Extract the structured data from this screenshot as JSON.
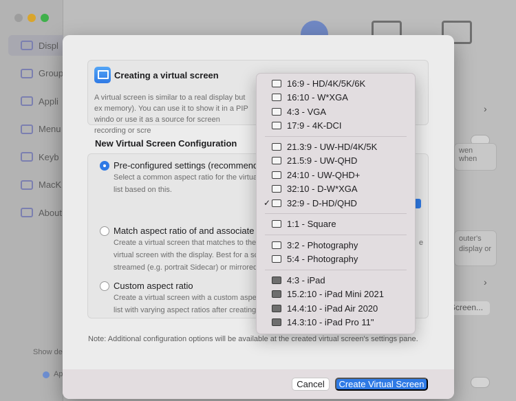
{
  "background": {
    "sidebar_items": [
      {
        "label": "Displ",
        "icon": "display-icon",
        "active": true
      },
      {
        "label": "Group",
        "icon": "group-icon"
      },
      {
        "label": "Appli",
        "icon": "app-icon"
      },
      {
        "label": "Menu",
        "icon": "menu-icon"
      },
      {
        "label": "Keyb",
        "icon": "keyboard-icon"
      },
      {
        "label": "MacK",
        "icon": "gear-icon"
      },
      {
        "label": "About",
        "icon": "tag-icon"
      }
    ],
    "bottom_left": "Show de",
    "bottom_row_label": "Ap",
    "right_fragments": [
      "wen when",
      "outer's",
      "display or"
    ],
    "screen_button": "Screen..."
  },
  "dialog": {
    "info_title": "Creating a virtual screen",
    "info_body": "A virtual screen is similar to a real display but ex memory). You can use it to show it in a PIP windo or use it as a source for screen recording or scre",
    "section_title": "New Virtual Screen Configuration",
    "options": [
      {
        "label": "Pre-configured settings (recommend",
        "selected": true,
        "desc": [
          "Select a common aspect ratio for the virtua",
          "list based on this."
        ]
      },
      {
        "label": "Match aspect ratio of and associate t",
        "selected": false,
        "desc": [
          "Create a virtual screen that matches to the",
          "virtual screen with the display. Best for a sc",
          "streamed (e.g. portrait Sidecar) or mirrored"
        ]
      },
      {
        "label": "Custom aspect ratio",
        "selected": false,
        "desc": [
          "Create a virtual screen with a custom aspect",
          "list with varying aspect ratios after creating"
        ]
      }
    ],
    "edge_fragment": "e",
    "note": "Note: Additional configuration options will be available at the created virtual screen's settings pane.",
    "cancel_label": "Cancel",
    "create_label": "Create Virtual Screen"
  },
  "menu": {
    "groups": [
      [
        {
          "label": "16:9 - HD/4K/5K/6K",
          "checked": false,
          "icon": "display-outline-icon"
        },
        {
          "label": "16:10 - W*XGA",
          "checked": false,
          "icon": "display-outline-icon"
        },
        {
          "label": "4:3 - VGA",
          "checked": false,
          "icon": "display-outline-icon"
        },
        {
          "label": "17:9 - 4K-DCI",
          "checked": false,
          "icon": "display-outline-icon"
        }
      ],
      [
        {
          "label": "21.3:9 - UW-HD/4K/5K",
          "checked": false,
          "icon": "display-outline-icon"
        },
        {
          "label": "21.5:9 - UW-QHD",
          "checked": false,
          "icon": "display-outline-icon"
        },
        {
          "label": "24:10 - UW-QHD+",
          "checked": false,
          "icon": "display-outline-icon"
        },
        {
          "label": "32:10 - D-W*XGA",
          "checked": false,
          "icon": "display-outline-icon"
        },
        {
          "label": "32:9 - D-HD/QHD",
          "checked": true,
          "icon": "display-outline-icon"
        }
      ],
      [
        {
          "label": "1:1 - Square",
          "checked": false,
          "icon": "display-outline-icon"
        }
      ],
      [
        {
          "label": "3:2 - Photography",
          "checked": false,
          "icon": "display-outline-icon"
        },
        {
          "label": "5:4 - Photography",
          "checked": false,
          "icon": "display-outline-icon"
        }
      ],
      [
        {
          "label": "4:3 - iPad",
          "checked": false,
          "icon": "ipad-icon"
        },
        {
          "label": "15.2:10 - iPad Mini 2021",
          "checked": false,
          "icon": "ipad-icon"
        },
        {
          "label": "14.4:10 - iPad Air 2020",
          "checked": false,
          "icon": "ipad-icon"
        },
        {
          "label": "14.3:10 - iPad Pro 11\"",
          "checked": false,
          "icon": "ipad-icon"
        }
      ]
    ],
    "check_glyph": "✓"
  },
  "colors": {
    "accent": "#2f7ae5",
    "dialog_bg": "#ececec",
    "menu_bg": "#e2dde0"
  }
}
